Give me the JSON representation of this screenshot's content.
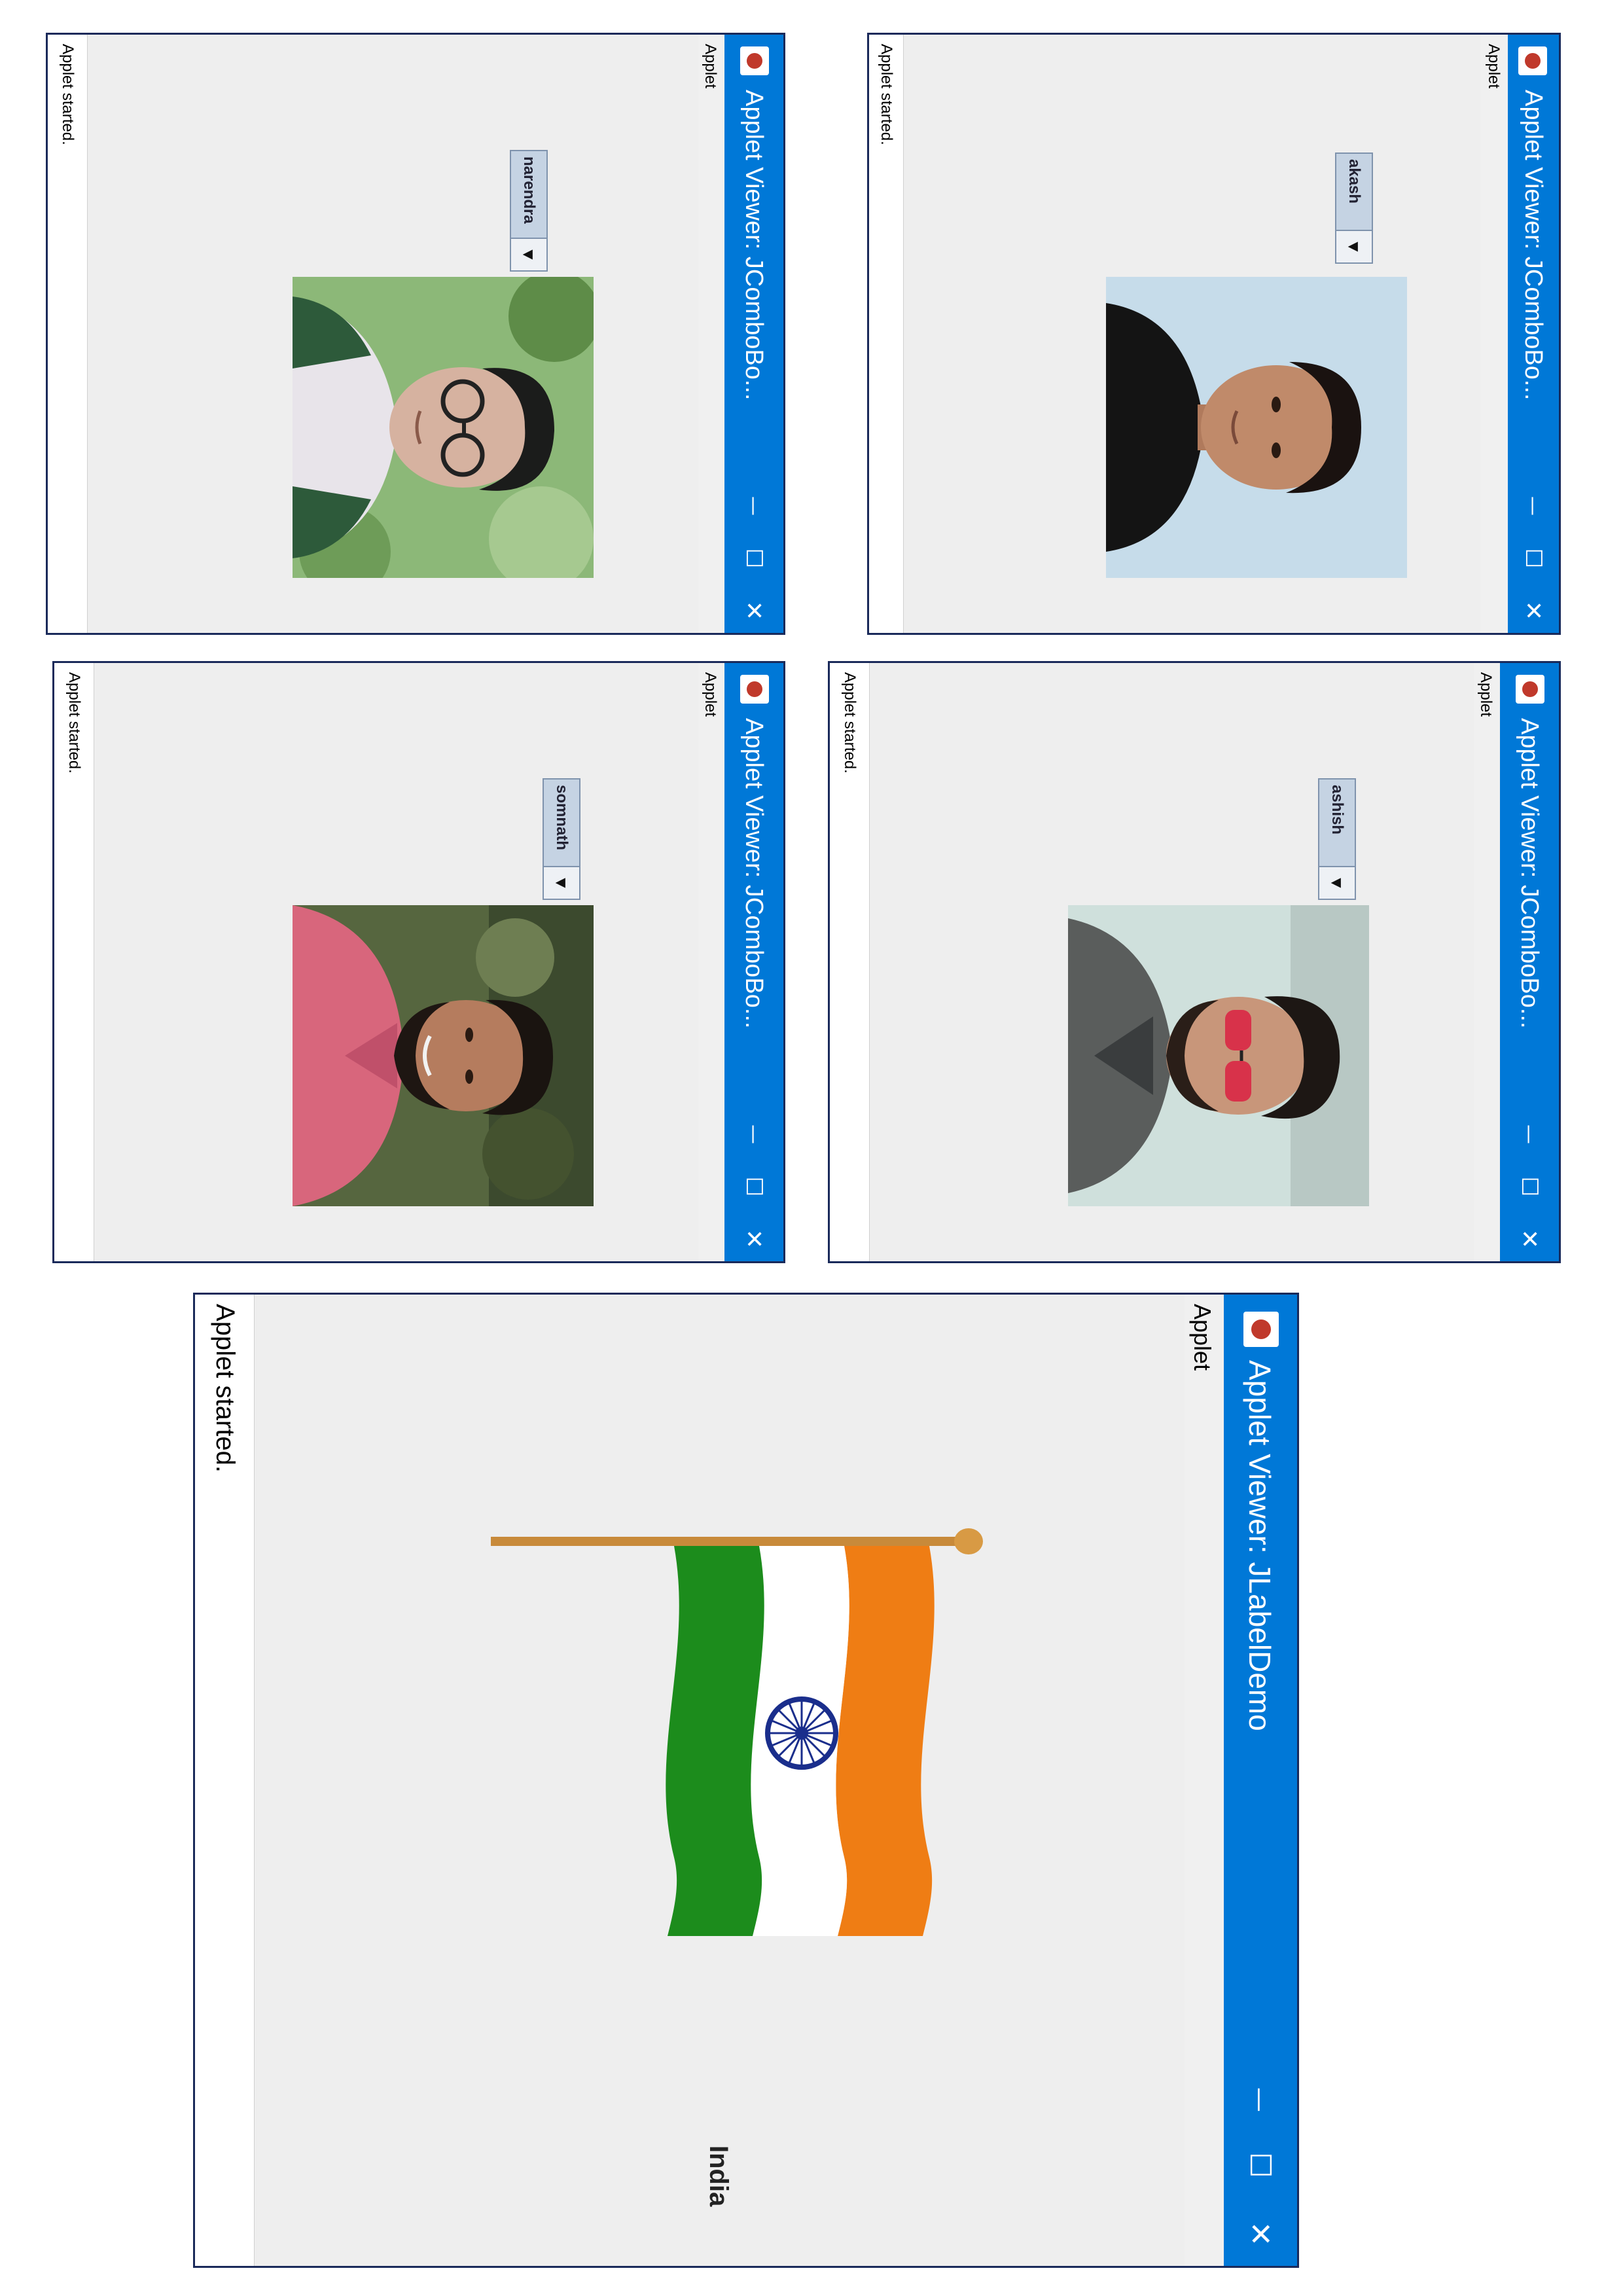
{
  "combo_windows": [
    {
      "title": "Applet Viewer: JComboBo...",
      "menu_label": "Applet",
      "status": "Applet started.",
      "selected": "akash",
      "photo": "portrait of a young man with dark hair in a black t-shirt against a light blue background",
      "colors": {
        "bg": "#bfd6e6",
        "shirt": "#151515",
        "skin": "#c08a6a",
        "hair": "#1a1210"
      }
    },
    {
      "title": "Applet Viewer: JComboBo...",
      "menu_label": "Applet",
      "status": "Applet started.",
      "selected": "narendra",
      "photo": "portrait of a young man with glasses outdoors among green leaves",
      "colors": {
        "bg": "#7fa86a",
        "shirt": "#e8e4ea",
        "skin": "#d6b2a0",
        "hair": "#1b1c1b"
      }
    },
    {
      "title": "Applet Viewer: JComboBo...",
      "menu_label": "Applet",
      "status": "Applet started.",
      "selected": "ashish",
      "photo": "portrait of a bearded man wearing red sunglasses and a checked shirt",
      "colors": {
        "bg": "#c8dcd9",
        "shirt": "#5a5d5c",
        "skin": "#c8967a",
        "hair": "#1d1714"
      }
    },
    {
      "title": "Applet Viewer: JComboBo...",
      "menu_label": "Applet",
      "status": "Applet started.",
      "selected": "somnath",
      "photo": "portrait of a smiling bearded man in a pink shirt outdoors",
      "colors": {
        "bg": "#4b5a3a",
        "shirt": "#d8667c",
        "skin": "#b57c5e",
        "hair": "#1a1410"
      }
    }
  ],
  "label_window": {
    "title": "Applet Viewer: JLabelDemo",
    "menu_label": "Applet",
    "status": "Applet started.",
    "label_text": "India",
    "image": "waving Indian national flag on a pole",
    "colors": {
      "saffron": "#ef7d14",
      "white": "#ffffff",
      "green": "#1c8c1c",
      "chakra": "#1a2e8c",
      "pole": "#c88a3a"
    }
  },
  "titlebar_buttons": {
    "minimize": "—",
    "maximize": "☐",
    "close": "✕"
  },
  "accent_color": "#0078d7"
}
